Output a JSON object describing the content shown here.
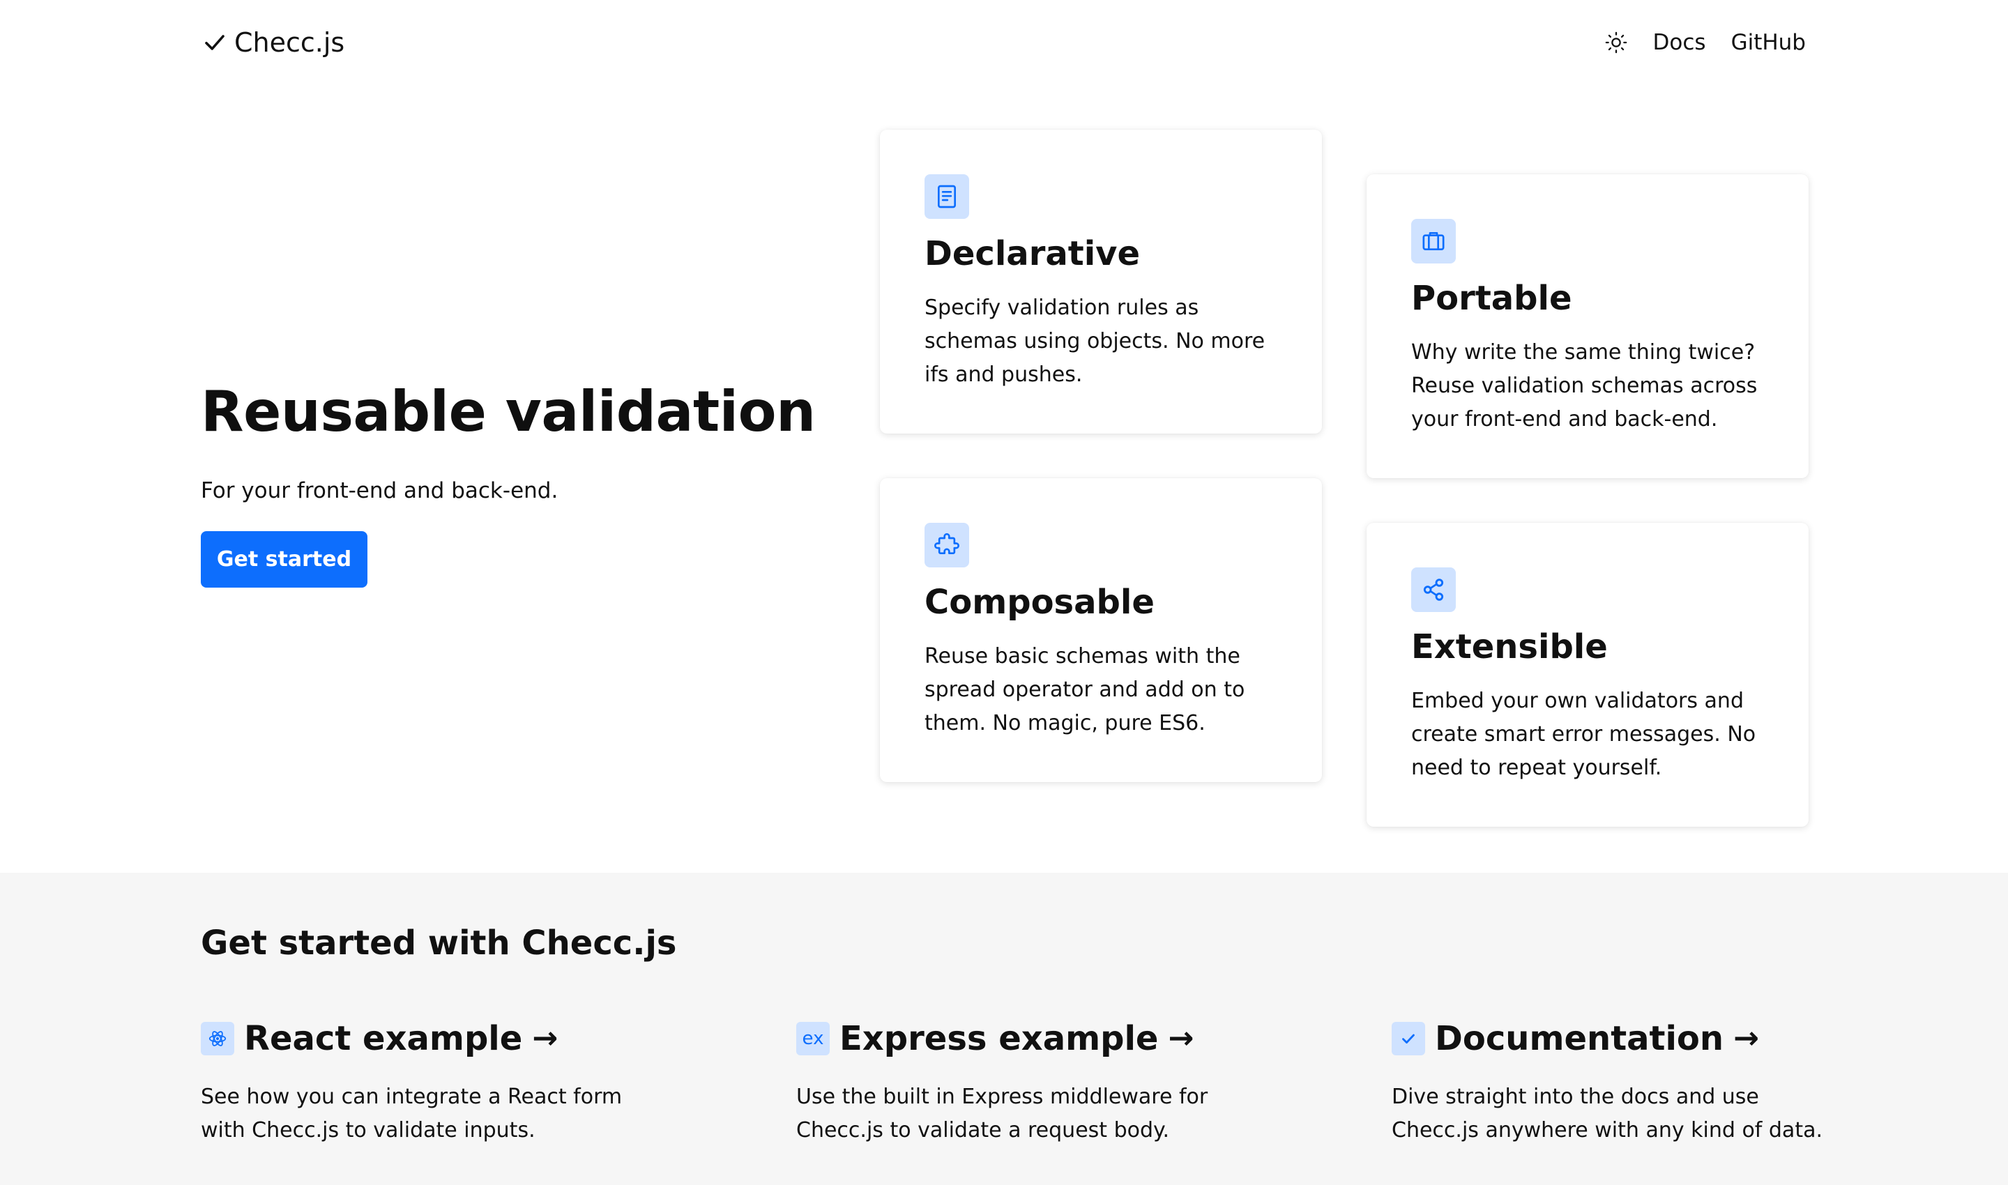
{
  "header": {
    "brand": "Checc.js",
    "nav": {
      "docs": "Docs",
      "github": "GitHub"
    }
  },
  "hero": {
    "title": "Reusable validation",
    "subtitle": "For your front-end and back-end.",
    "cta": "Get started"
  },
  "features": {
    "declarative": {
      "title": "Declarative",
      "lines": [
        "Specify validation rules as",
        "schemas using objects. No more",
        "ifs and pushes."
      ]
    },
    "composable": {
      "title": "Composable",
      "lines": [
        "Reuse basic schemas with the",
        "spread operator and add on to",
        "them. No magic, pure ES6."
      ]
    },
    "portable": {
      "title": "Portable",
      "lines": [
        "Why write the same thing twice?",
        "Reuse validation schemas across",
        "your front-end and back-end."
      ]
    },
    "extensible": {
      "title": "Extensible",
      "lines": [
        "Embed your own validators and",
        "create smart error messages. No",
        "need to repeat yourself."
      ]
    }
  },
  "getting_started": {
    "title": "Get started with Checc.js",
    "react": {
      "title": "React example",
      "arrow": "→",
      "lines": [
        "See how you can integrate a React form",
        "with Checc.js to validate inputs."
      ]
    },
    "express": {
      "title": "Express example",
      "arrow": "→",
      "icon_text": "ex",
      "lines": [
        "Use the built in Express middleware for",
        "Checc.js to validate a request body."
      ]
    },
    "docs": {
      "title": "Documentation",
      "arrow": "→",
      "lines": [
        "Dive straight into the docs and use",
        "Checc.js anywhere with any kind of data."
      ]
    }
  },
  "colors": {
    "accent": "#0d6efd",
    "icon_bg": "#cfe2ff",
    "section_bg": "#f6f6f6"
  }
}
